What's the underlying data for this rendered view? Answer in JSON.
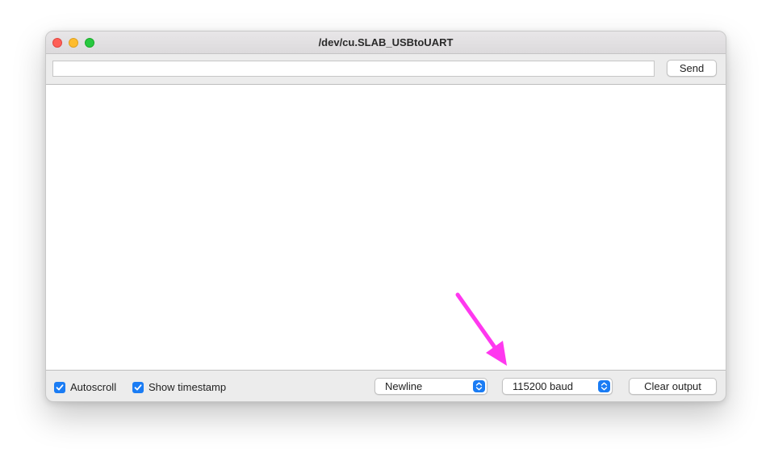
{
  "window": {
    "title": "/dev/cu.SLAB_USBtoUART"
  },
  "input_bar": {
    "input_value": "",
    "send_label": "Send"
  },
  "output": {
    "text": ""
  },
  "footer": {
    "autoscroll": {
      "label": "Autoscroll",
      "checked": true
    },
    "show_timestamp": {
      "label": "Show timestamp",
      "checked": true
    },
    "line_ending": {
      "selected": "Newline"
    },
    "baud_rate": {
      "selected": "115200 baud"
    },
    "clear_label": "Clear output"
  },
  "colors": {
    "accent": "#1a7cf4",
    "annotation_arrow": "#ff38ef"
  },
  "annotations": {
    "arrow_icon": "arrow-pointing-to-baud-select"
  }
}
